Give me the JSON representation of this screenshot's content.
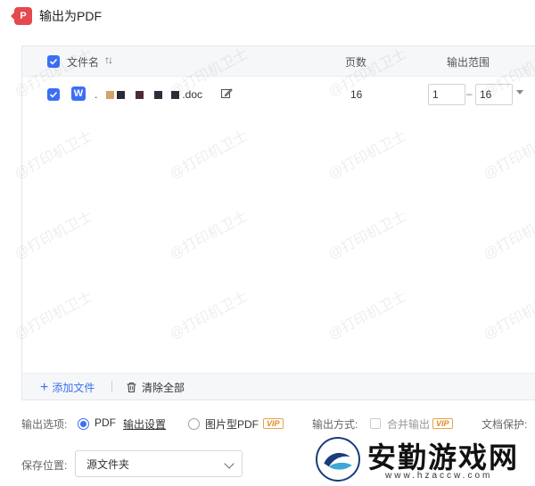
{
  "app": {
    "icon_letter": "P",
    "title": "输出为PDF",
    "accent": "#3b6ff5",
    "brand_red": "#e5484d"
  },
  "table": {
    "columns": {
      "name": "文件名",
      "sort_glyph": "↑↓",
      "pages": "页数",
      "range": "输出范围"
    },
    "rows": [
      {
        "type_letter": "W",
        "name_prefix": ".",
        "name_suffix": ".doc",
        "pages": "16",
        "range_from": "1",
        "range_dash": "–",
        "range_to": "16"
      }
    ]
  },
  "watermark_text": "@打印机卫士",
  "footer": {
    "add_label": "添加文件",
    "plus_glyph": "+",
    "clear_label": "清除全部"
  },
  "options": {
    "output_option_label": "输出选项:",
    "pdf_label": "PDF",
    "output_settings_link": "输出设置",
    "image_pdf_label": "图片型PDF",
    "vip_badge": "VIP",
    "output_mode_label": "输出方式:",
    "merge_label": "合并输出",
    "doc_protect_label": "文档保护:"
  },
  "save": {
    "label": "保存位置:",
    "selected": "源文件夹"
  },
  "brand": {
    "name": "安勤游戏网",
    "url": "www.hzaccw.com"
  }
}
